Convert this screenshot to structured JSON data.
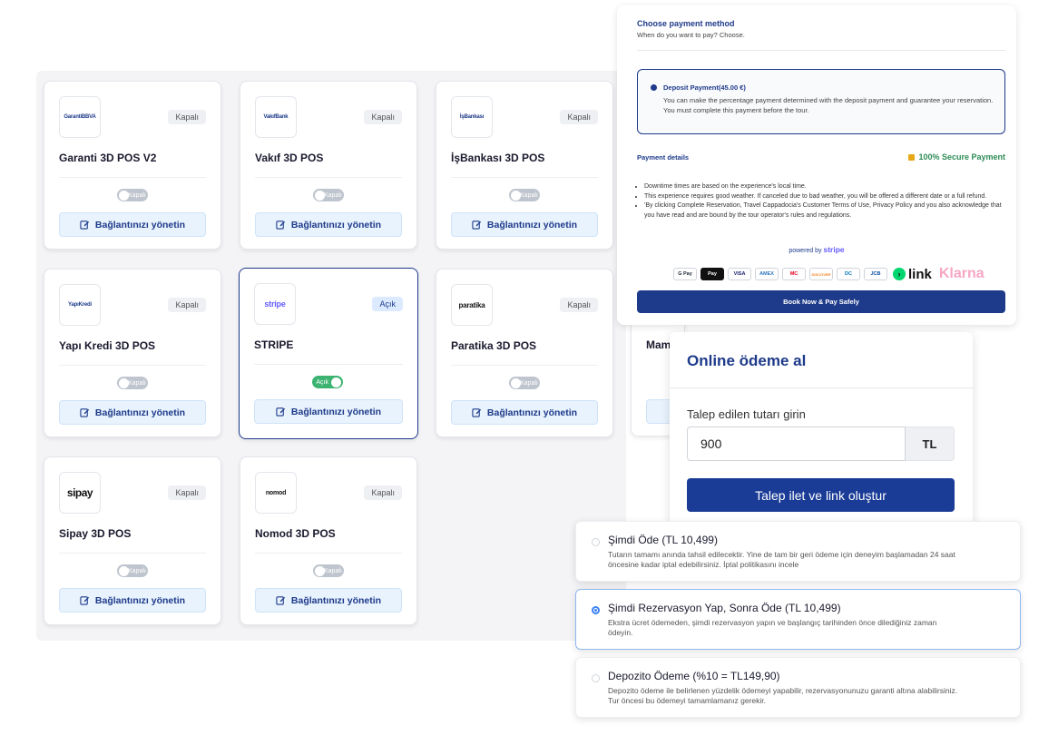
{
  "integrations": [
    {
      "logo": "GarantiBBVA",
      "title": "Garanti 3D POS V2",
      "status": "Kapalı",
      "toggle": "Kapalı",
      "on": false,
      "manage": "Bağlantınızı yönetin"
    },
    {
      "logo": "VakıfBank",
      "title": "Vakıf 3D POS",
      "status": "Kapalı",
      "toggle": "Kapalı",
      "on": false,
      "manage": "Bağlantınızı yönetin"
    },
    {
      "logo": "İşBankası",
      "title": "İşBankası 3D POS",
      "status": "Kapalı",
      "toggle": "Kapalı",
      "on": false,
      "manage": "Bağlantınızı yönetin"
    },
    {
      "logo": "YapıKredi",
      "title": "Yapı Kredi 3D POS",
      "status": "Kapalı",
      "toggle": "Kapalı",
      "on": false,
      "manage": "Bağlantınızı yönetin"
    },
    {
      "logo": "stripe",
      "title": "STRIPE",
      "status": "Açık",
      "toggle": "Açık",
      "on": true,
      "manage": "Bağlantınızı yönetin"
    },
    {
      "logo": "paratika",
      "title": "Paratika 3D POS",
      "status": "Kapalı",
      "toggle": "Kapalı",
      "on": false,
      "manage": "Bağlantınızı yönetin"
    },
    {
      "logo": "sipay",
      "title": "Sipay 3D POS",
      "status": "Kapalı",
      "toggle": "Kapalı",
      "on": false,
      "manage": "Bağlantınızı yönetin"
    },
    {
      "logo": "nomod",
      "title": "Nomod 3D POS",
      "status": "Kapalı",
      "toggle": "Kapalı",
      "on": false,
      "manage": "Bağlantınızı yönetin"
    }
  ],
  "partial_card_title": "Mam",
  "payment_method": {
    "title": "Choose payment method",
    "subtitle": "When do you want to pay? Choose.",
    "deposit_title": "Deposit Payment(45.00 €)",
    "deposit_desc": "You can make the percentage payment determined with the deposit payment and guarantee your reservation. You must complete this payment before the tour.",
    "details_label": "Payment details",
    "secure_label": "100% Secure Payment",
    "notes": [
      "Downtime times are based on the experience's local time.",
      "This experience requires good weather. If canceled due to bad weather, you will be offered a different date or a full refund.",
      "'By clicking Complete Reservation, Travel Cappadocia's Customer Terms of Use, Privacy Policy and you also acknowledge that you have read and are bound by the tour operator's rules and regulations."
    ],
    "powered_by": "powered by",
    "powered_brand": "stripe",
    "payment_icons": [
      "G Pay",
      "Pay",
      "VISA",
      "AMEX",
      "MC",
      "DISCOVER",
      "DC",
      "JCB"
    ],
    "link_label": "link",
    "klarna_label": "Klarna",
    "book_button": "Book Now & Pay Safely"
  },
  "online_payment": {
    "title": "Online ödeme al",
    "amount_label": "Talep edilen tutarı girin",
    "amount_value": "900",
    "currency": "TL",
    "create_button": "Talep ilet ve link oluştur"
  },
  "payment_options": [
    {
      "title": "Şimdi Öde (TL 10,499)",
      "desc": "Tutarın tamamı anında tahsil edilecektir. Yine de tam bir geri ödeme için deneyim başlamadan 24 saat öncesine kadar iptal edebilirsiniz. İptal politikasını incele",
      "selected": false
    },
    {
      "title": "Şimdi Rezervasyon Yap, Sonra Öde (TL 10,499)",
      "desc": "Ekstra ücret ödemeden, şimdi rezervasyon yapın ve başlangıç tarihinden önce dilediğiniz zaman ödeyin.",
      "selected": true
    },
    {
      "title": "Depozito Ödeme (%10 = TL149,90)",
      "desc": "Depozito ödeme ile belirlenen yüzdelik ödemeyi yapabilir, rezervasyonunuzu garanti altına alabilirsiniz. Tur öncesi bu ödemeyi tamamlamanız gerekir.",
      "selected": false
    }
  ],
  "colors": {
    "brand": "#1e3a8a",
    "toggle_on": "#3cb371",
    "toggle_off": "#bfc5ce",
    "secure": "#2e8b57",
    "stripe": "#635bff",
    "klarna": "#f6a6c4"
  }
}
